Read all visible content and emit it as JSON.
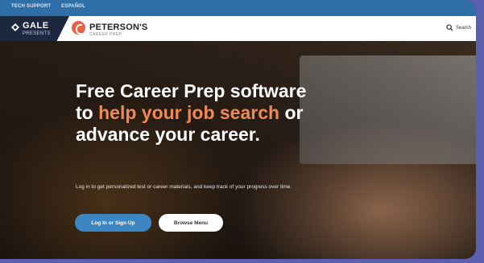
{
  "topbar": {
    "links": [
      "TECH SUPPORT",
      "ESPAÑOL"
    ]
  },
  "header": {
    "gale_name": "GALE",
    "gale_sub": "PRESENTS",
    "peterson_name": "PETERSON'S",
    "peterson_sub": "CAREER PREP",
    "search_label": "Search"
  },
  "hero": {
    "headline_part1": "Free Career Prep software to ",
    "headline_accent": "help your job search",
    "headline_part2": " or advance your career.",
    "description": "Log in to get personalized test or career materials, and keep track of your progress over time.",
    "login_button": "Log In or Sign Up",
    "browse_button": "Browse Menu"
  },
  "colors": {
    "accent": "#f08a55",
    "primary_button": "#3c86c4",
    "topbar": "#2f6fa7",
    "gale_block": "#1d2840"
  }
}
